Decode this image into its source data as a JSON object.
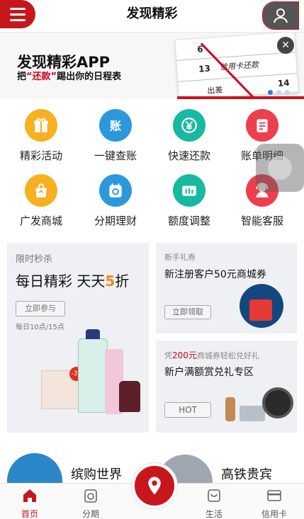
{
  "header": {
    "title": "发现精彩"
  },
  "banner": {
    "title": "发现精彩APP",
    "sub_prefix": "把",
    "sub_highlight": "“还款”",
    "sub_suffix": "踢出你的日程表",
    "cal_numbers": [
      "6",
      "13",
      "14"
    ],
    "cal_text": [
      "信用卡还款",
      "出差"
    ],
    "slide_count": 3,
    "active_slide": 1
  },
  "grid": {
    "items": [
      {
        "label": "精彩活动",
        "icon": "gift-icon",
        "color": "#f6b020"
      },
      {
        "label": "一键查账",
        "icon": "account-icon",
        "color": "#2b98dd"
      },
      {
        "label": "快速还款",
        "icon": "yen-icon",
        "color": "#19b8a0"
      },
      {
        "label": "账单明细",
        "icon": "bill-icon",
        "color": "#ee3f4e"
      },
      {
        "label": "广发商城",
        "icon": "shopping-bag-icon",
        "color": "#f6b020"
      },
      {
        "label": "分期理财",
        "icon": "calendar-icon",
        "color": "#2b98dd"
      },
      {
        "label": "额度调整",
        "icon": "card-adjust-icon",
        "color": "#19b8a0"
      },
      {
        "label": "智能客服",
        "icon": "customer-service-icon",
        "color": "#ee3f4e"
      }
    ]
  },
  "promo_big": {
    "tag": "限时秒杀",
    "title_part1": "每日精彩  天天",
    "title_five": "5",
    "title_part2": "折",
    "button": "立即参与",
    "note": "每日10点/15点",
    "sale_badge": "-30"
  },
  "promo_small": [
    {
      "tag": "新手礼券",
      "title": "新注册客户50元商城券",
      "button": "立即领取"
    },
    {
      "tag_prefix": "凭",
      "tag_amount": "200元",
      "tag_suffix": "商城券轻松兑好礼",
      "title": "新户满额赏兑礼专区",
      "button": "HOT"
    }
  ],
  "lower": {
    "left": "缤购世界",
    "right": "高铁贵宾"
  },
  "tabbar": {
    "tabs": [
      {
        "label": "首页",
        "active": true
      },
      {
        "label": "分期",
        "active": false
      },
      {
        "label": "生活",
        "active": false
      },
      {
        "label": "信用卡",
        "active": false
      }
    ]
  },
  "colors": {
    "brand_red": "#c8161d",
    "accent_orange": "#f08a1c"
  }
}
